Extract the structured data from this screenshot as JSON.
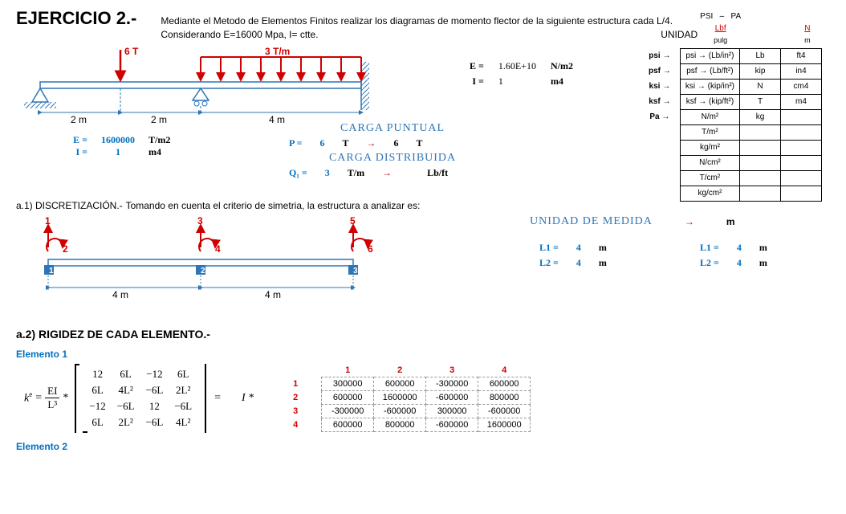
{
  "title": "EJERCICIO 2.-",
  "description1": "Mediante el Metodo de Elementos Finitos realizar los diagramas de momento flector de la siguiente estructura cada L/4.",
  "description2": "Considerando E=16000 Mpa, I= ctte.",
  "unidad_label": "UNIDAD",
  "beam": {
    "point_load": "6 T",
    "dist_load": "3 T/m",
    "span1": "2 m",
    "span2": "2 m",
    "span3": "4 m"
  },
  "params": {
    "E_label": "E =",
    "E_val": "1.60E+10",
    "E_unit": "N/m2",
    "I_label": "I =",
    "I_val": "1",
    "I_unit": "m4"
  },
  "units_header": {
    "psi": "PSI",
    "dash": "–",
    "pa": "PA",
    "lbf": "Lbf",
    "pulg": "pulg",
    "n": "N",
    "m": "m"
  },
  "units_rows_labels": [
    "psi →",
    "psf →",
    "ksi →",
    "ksf →",
    "Pa →"
  ],
  "units_table": [
    [
      "psi → (Lb/in²)",
      "Lb",
      "ft4"
    ],
    [
      "psf → (Lb/ft²)",
      "kip",
      "in4"
    ],
    [
      "ksi → (kip/in²)",
      "N",
      "cm4"
    ],
    [
      "ksf → (kip/ft²)",
      "T",
      "m4"
    ],
    [
      "N/m²",
      "kg",
      ""
    ],
    [
      "T/m²",
      "",
      ""
    ],
    [
      "kg/m²",
      "",
      ""
    ],
    [
      "N/cm²",
      "",
      ""
    ],
    [
      "T/cm²",
      "",
      ""
    ],
    [
      "kg/cm²",
      "",
      ""
    ]
  ],
  "inputs": {
    "E": {
      "label": "E =",
      "val": "1600000",
      "unit": "T/m2"
    },
    "I": {
      "label": "I =",
      "val": "1",
      "unit": "m4"
    }
  },
  "carga": {
    "puntual_title": "CARGA PUNTUAL",
    "P_label": "P =",
    "P_val": "6",
    "P_unit1": "T",
    "P_arrow": "→",
    "P_val2": "6",
    "P_unit2": "T",
    "dist_title": "CARGA DISTRIBUIDA",
    "Q_label": "Q₁ =",
    "Q_val": "3",
    "Q_unit1": "T/m",
    "Q_arrow": "→",
    "Q_unit2": "Lb/ft"
  },
  "sec_a1": {
    "title": "a.1) DISCRETIZACIÓN.-",
    "sub": "Tomando en cuenta el criterio de simetria, la estructura a analizar es:"
  },
  "unidad_medida": {
    "label": "UNIDAD DE MEDIDA",
    "arrow": "→",
    "val": "m"
  },
  "disc": {
    "nodes": [
      "1",
      "2",
      "3",
      "4",
      "5",
      "6"
    ],
    "elems": [
      "1",
      "2",
      "3"
    ],
    "span1": "4 m",
    "span2": "4 m"
  },
  "L_vals": {
    "L1_label": "L1 =",
    "L1_val": "4",
    "L1_unit": "m",
    "L2_label": "L2 =",
    "L2_val": "4",
    "L2_unit": "m"
  },
  "sec_a2": {
    "title": "a.2) RIGIDEZ DE CADA ELEMENTO.-"
  },
  "elem1_label": "Elemento 1",
  "elem2_label": "Elemento 2",
  "matrix_sym": {
    "ke": "k",
    "sup_e": "e",
    "eq": "=",
    "EI": "EI",
    "L3": "L³",
    "star": "*",
    "I_star": "I *",
    "rows": [
      [
        "12",
        "6L",
        "−12",
        "6L"
      ],
      [
        "6L",
        "4L²",
        "−6L",
        "2L²"
      ],
      [
        "−12",
        "−6L",
        "12",
        "−6L"
      ],
      [
        "6L",
        "2L²",
        "−6L",
        "4L²"
      ]
    ]
  },
  "matrix_num": {
    "col_hdrs": [
      "1",
      "2",
      "3",
      "4"
    ],
    "row_hdrs": [
      "1",
      "2",
      "3",
      "4"
    ],
    "rows": [
      [
        "300000",
        "600000",
        "-300000",
        "600000"
      ],
      [
        "600000",
        "1600000",
        "-600000",
        "800000"
      ],
      [
        "-300000",
        "-600000",
        "300000",
        "-600000"
      ],
      [
        "600000",
        "800000",
        "-600000",
        "1600000"
      ]
    ]
  }
}
